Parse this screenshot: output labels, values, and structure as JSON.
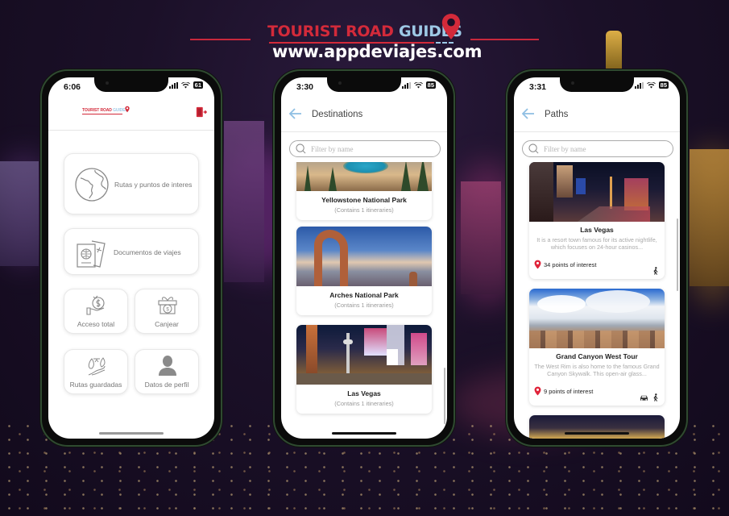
{
  "brand": {
    "title_part1": "TOURIST ROAD ",
    "title_part2": "GUIDES",
    "url": "www.appdeviajes.com",
    "colors": {
      "red": "#d32a3a",
      "blue": "#9ec9e6"
    }
  },
  "phones": [
    {
      "status": {
        "time": "6:06",
        "battery": "61"
      },
      "header": {
        "logo_part1": "TOURIST ROAD ",
        "logo_part2": "GUIDES",
        "exit_icon": "exit-door-icon"
      },
      "menu": [
        {
          "label": "Rutas y puntos de interes",
          "icon": "globe-icon"
        },
        {
          "label": "Documentos de viajes",
          "icon": "passport-ticket-icon"
        },
        {
          "label": "Acceso total",
          "icon": "hand-money-icon"
        },
        {
          "label": "Canjear",
          "icon": "gift-coin-icon"
        },
        {
          "label": "Rutas guardadas",
          "icon": "forest-path-icon"
        },
        {
          "label": "Datos de perfil",
          "icon": "user-icon"
        }
      ]
    },
    {
      "status": {
        "time": "3:30",
        "battery": "85"
      },
      "header": {
        "title": "Destinations"
      },
      "filter": {
        "placeholder": "Filter by name",
        "value": ""
      },
      "items": [
        {
          "name": "Yellowstone National Park",
          "subtitle": "(Contains 1 itineraries)"
        },
        {
          "name": "Arches National Park",
          "subtitle": "(Contains 1 itineraries)"
        },
        {
          "name": "Las Vegas",
          "subtitle": "(Contains 1 itineraries)"
        }
      ]
    },
    {
      "status": {
        "time": "3:31",
        "battery": "85"
      },
      "header": {
        "title": "Paths"
      },
      "filter": {
        "placeholder": "Filter by name",
        "value": ""
      },
      "items": [
        {
          "name": "Las Vegas",
          "description": "It is a resort town famous for its active nightlife, which focuses on 24-hour casinos...",
          "points": "34 points of interest",
          "modes": [
            "walk"
          ]
        },
        {
          "name": "Grand Canyon West Tour",
          "description": "The West Rim is also home to the famous Grand Canyon Skywalk. This open-air glass...",
          "points": "9 points of interest",
          "modes": [
            "car",
            "walk"
          ]
        }
      ]
    }
  ]
}
